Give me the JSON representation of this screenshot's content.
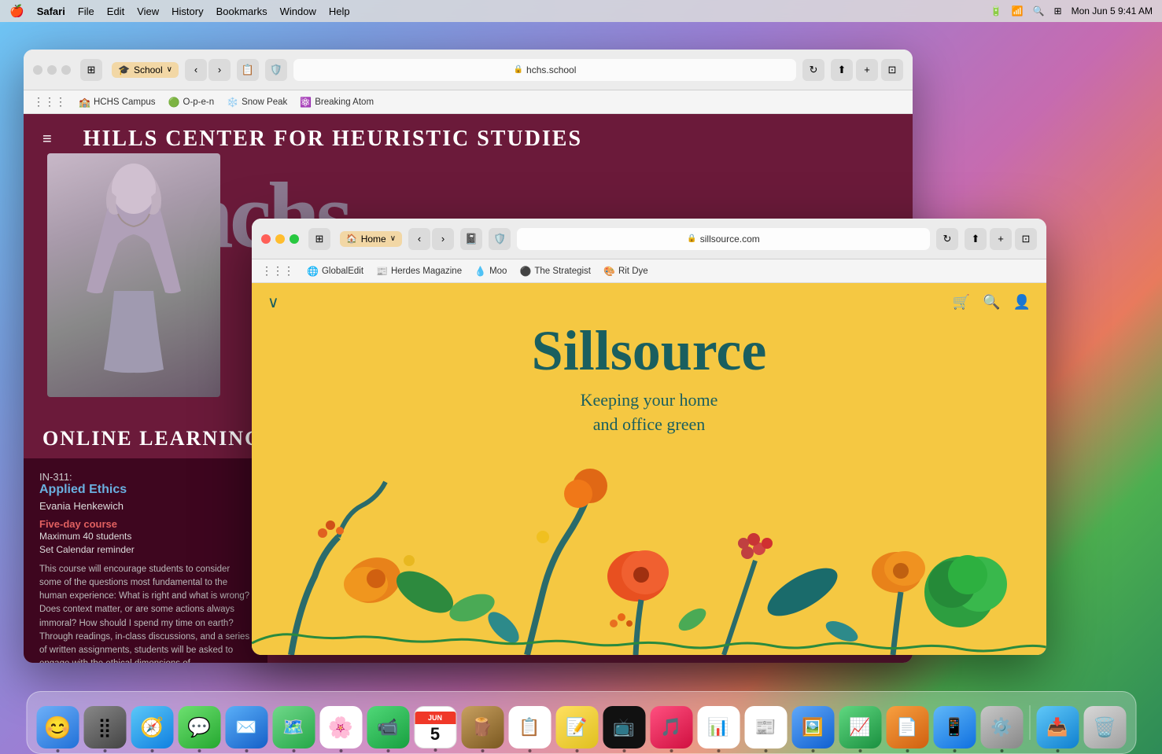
{
  "menubar": {
    "apple": "🍎",
    "app": "Safari",
    "menus": [
      "File",
      "Edit",
      "View",
      "History",
      "Bookmarks",
      "Window",
      "Help"
    ],
    "time": "Mon Jun 5  9:41 AM",
    "battery": "🔋",
    "wifi": "WiFi"
  },
  "browser_back": {
    "title": "School",
    "url": "hchs.school",
    "bookmarks": [
      {
        "icon": "🏫",
        "label": "HCHS Campus"
      },
      {
        "icon": "🟢",
        "label": "O-p-e-n"
      },
      {
        "icon": "❄️",
        "label": "Snow Peak"
      },
      {
        "icon": "⚛️",
        "label": "Breaking Atom"
      }
    ],
    "school": {
      "name": "HILLS CENTER FOR HEURISTIC STUDIES",
      "big_letters": "hchs",
      "section": "ONLINE LEARNING",
      "course": {
        "code": "IN-311:",
        "name": "Applied Ethics",
        "instructor": "Evania Henkewich",
        "duration_link": "Five-day course",
        "max_students": "Maximum 40 students",
        "reminder": "Set Calendar reminder",
        "description": "This course will encourage students to consider some of the questions most fundamental to the human experience: What is right and what is wrong? Does context matter, or are some actions always immoral? How should I spend my time on earth? Through readings, in-class discussions, and a series of written assignments, students will be asked to engage with the ethical dimensions of"
      }
    }
  },
  "browser_front": {
    "url": "sillsource.com",
    "tab_home": "Home",
    "bookmarks": [
      {
        "icon": "🌐",
        "label": "GlobalEdit"
      },
      {
        "icon": "📰",
        "label": "Herdes Magazine"
      },
      {
        "icon": "💧",
        "label": "Moo"
      },
      {
        "icon": "⚫",
        "label": "The Strategist"
      },
      {
        "icon": "🎨",
        "label": "Rit Dye"
      }
    ],
    "site": {
      "title": "Sillsource",
      "subtitle": "Keeping your home\nand office green"
    }
  },
  "dock": {
    "items": [
      {
        "emoji": "😊",
        "name": "finder",
        "color": "#2196F3"
      },
      {
        "emoji": "🟣",
        "name": "launchpad",
        "color": "#9C27B0"
      },
      {
        "emoji": "🧭",
        "name": "safari",
        "color": "#2196F3"
      },
      {
        "emoji": "💬",
        "name": "messages",
        "color": "#4CAF50"
      },
      {
        "emoji": "📧",
        "name": "mail",
        "color": "#2196F3"
      },
      {
        "emoji": "🗺️",
        "name": "maps",
        "color": "#4CAF50"
      },
      {
        "emoji": "📷",
        "name": "photos",
        "color": "#FF9800"
      },
      {
        "emoji": "📹",
        "name": "facetime",
        "color": "#4CAF50"
      },
      {
        "emoji": "📅",
        "name": "calendar",
        "color": "#F44336"
      },
      {
        "emoji": "🪵",
        "name": "keka",
        "color": "#8B6914"
      },
      {
        "emoji": "📋",
        "name": "reminders",
        "color": "#FF5722"
      },
      {
        "emoji": "📝",
        "name": "notes",
        "color": "#FFEB3B"
      },
      {
        "emoji": "📺",
        "name": "apple-tv",
        "color": "#1a1a1a"
      },
      {
        "emoji": "🎵",
        "name": "music",
        "color": "#FF2D55"
      },
      {
        "emoji": "📊",
        "name": "freeform",
        "color": "#2196F3"
      },
      {
        "emoji": "📰",
        "name": "news",
        "color": "#FF3B30"
      },
      {
        "emoji": "🪣",
        "name": "keynote2",
        "color": "#2196F3"
      },
      {
        "emoji": "📈",
        "name": "numbers",
        "color": "#4CAF50"
      },
      {
        "emoji": "📄",
        "name": "pages",
        "color": "#FF9500"
      },
      {
        "emoji": "📱",
        "name": "appstore",
        "color": "#2196F3"
      },
      {
        "emoji": "⚙️",
        "name": "settings",
        "color": "#9E9E9E"
      },
      {
        "emoji": "📥",
        "name": "airdrop",
        "color": "#2196F3"
      },
      {
        "emoji": "🗑️",
        "name": "trash",
        "color": "#9E9E9E"
      }
    ]
  }
}
